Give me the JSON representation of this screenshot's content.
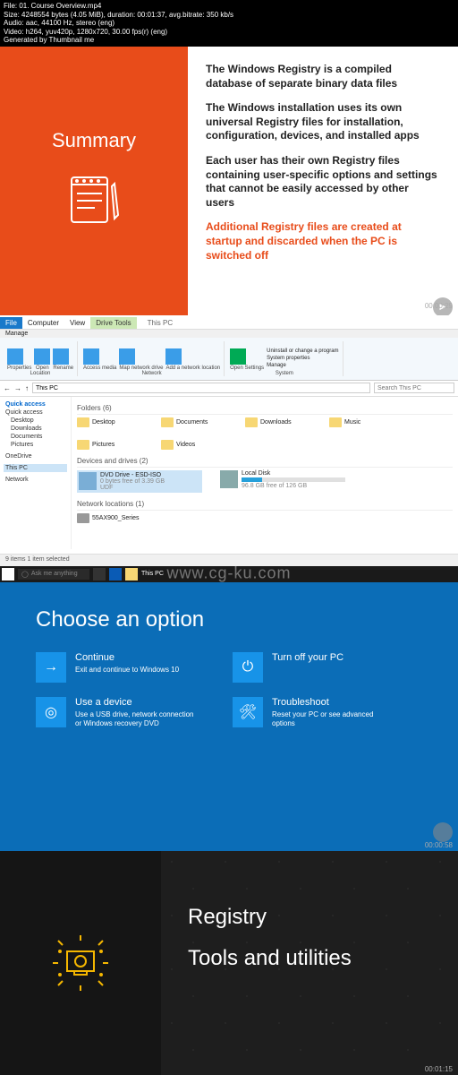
{
  "meta": {
    "l1": "File: 01. Course Overview.mp4",
    "l2": "Size: 4248554 bytes (4.05 MiB), duration: 00:01:37, avg.bitrate: 350 kb/s",
    "l3": "Audio: aac, 44100 Hz, stereo (eng)",
    "l4": "Video: h264, yuv420p, 1280x720, 30.00 fps(r) (eng)",
    "l5": "Generated by Thumbnail me"
  },
  "panel1": {
    "heading": "Summary",
    "p1": "The Windows Registry is a compiled database of separate binary data files",
    "p2": "The Windows installation uses its own universal Registry files for installation, configuration, devices, and installed apps",
    "p3": "Each user has their own Registry files containing user-specific options and settings that cannot be easily accessed by other users",
    "p4": "Additional Registry files are created at startup and discarded when the PC is switched off",
    "timestamp": "00:00:29"
  },
  "explorer": {
    "title": "This PC",
    "tabs": {
      "file": "File",
      "computer": "Computer",
      "view": "View",
      "drivetools": "Drive Tools",
      "manage": "Manage"
    },
    "ribbon": {
      "properties": "Properties",
      "open": "Open",
      "rename": "Rename",
      "access": "Access media",
      "mapdrive": "Map network drive",
      "addnet": "Add a network location",
      "opensettings": "Open Settings",
      "uninstall": "Uninstall or change a program",
      "sysprops": "System properties",
      "manage": "Manage",
      "g1": "Location",
      "g2": "Network",
      "g3": "System"
    },
    "breadcrumb": "This PC",
    "search_placeholder": "Search This PC",
    "nav": {
      "quick": "Quick access",
      "desktop": "Desktop",
      "downloads": "Downloads",
      "documents": "Documents",
      "pictures": "Pictures",
      "onedrive": "OneDrive",
      "thispc": "This PC",
      "network": "Network"
    },
    "sections": {
      "folders": "Folders (6)",
      "drives": "Devices and drives (2)",
      "netloc": "Network locations (1)"
    },
    "folders": [
      "Desktop",
      "Documents",
      "Downloads",
      "Music",
      "Pictures",
      "Videos"
    ],
    "drives": [
      {
        "name": "DVD Drive - ESD-ISO",
        "sub": "0 bytes free of 3.39 GB",
        "sub2": "UDF"
      },
      {
        "name": "Local Disk",
        "sub": "96.8 GB free of 126 GB"
      }
    ],
    "netloc": "55AX900_Series",
    "status": "9 items    1 item selected",
    "taskbar_search": "Ask me anything",
    "taskbar_title": "This PC"
  },
  "panel3": {
    "heading": "Choose an option",
    "options": [
      {
        "title": "Continue",
        "sub": "Exit and continue to Windows 10",
        "glyph": "→"
      },
      {
        "title": "Turn off your PC",
        "sub": "",
        "glyph": "⏻"
      },
      {
        "title": "Use a device",
        "sub": "Use a USB drive, network connection or Windows recovery DVD",
        "glyph": "◎"
      },
      {
        "title": "Troubleshoot",
        "sub": "Reset your PC or see advanced options",
        "glyph": "🛠"
      }
    ],
    "watermark": "www.cg-ku.com",
    "timestamp": "00:00:58"
  },
  "panel4": {
    "line1": "Registry",
    "line2": "Tools and utilities",
    "timestamp": "00:01:15"
  }
}
